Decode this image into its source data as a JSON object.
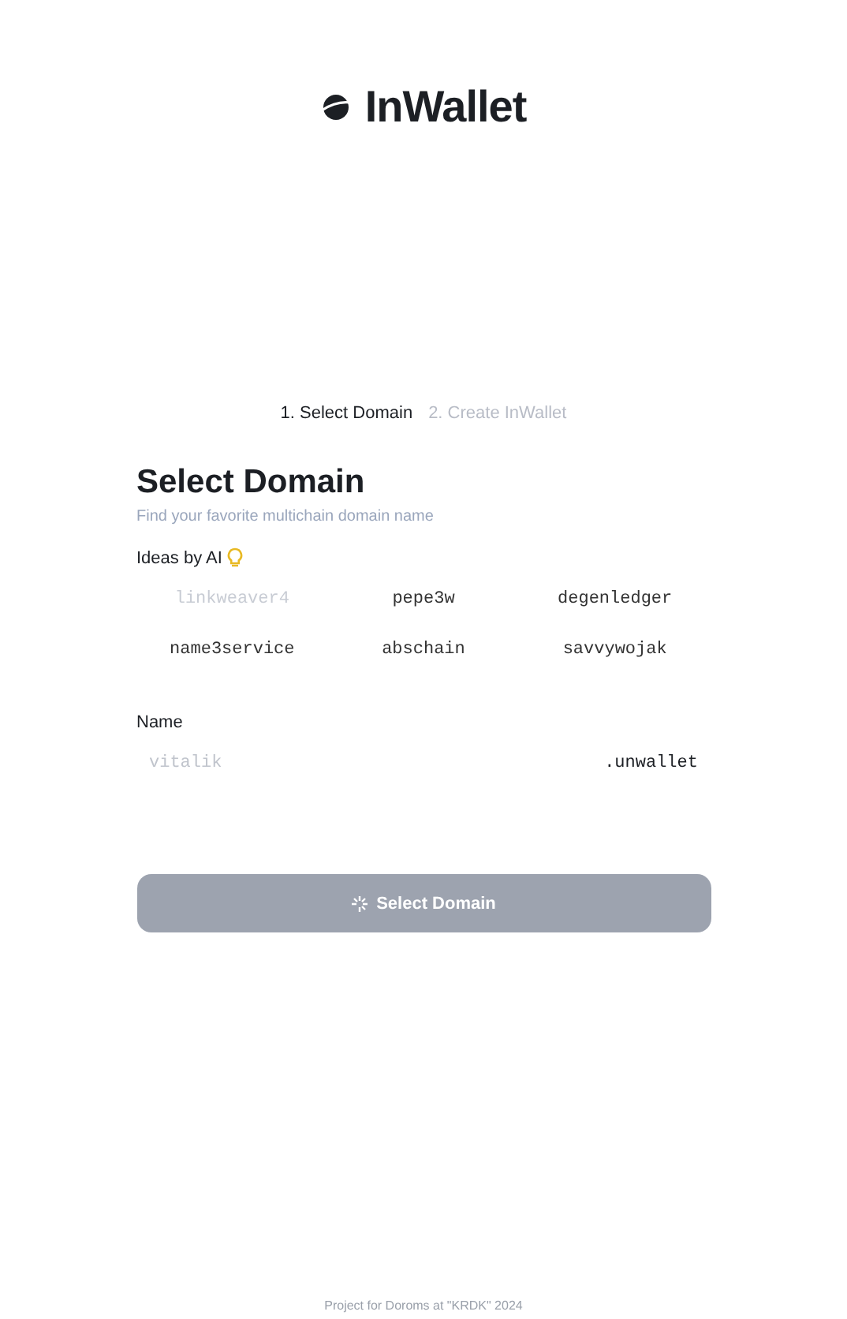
{
  "logo": {
    "text": "InWallet"
  },
  "steps": [
    {
      "label": "1. Select Domain",
      "selected": true
    },
    {
      "label": "2. Create InWallet",
      "selected": false
    }
  ],
  "heading": "Select Domain",
  "subtitle": "Find your favorite multichain domain name",
  "ideas": {
    "label": "Ideas by AI",
    "items": [
      {
        "text": "linkweaver4",
        "disabled": true
      },
      {
        "text": "pepe3w",
        "disabled": false
      },
      {
        "text": "degenledger",
        "disabled": false
      },
      {
        "text": "name3service",
        "disabled": false
      },
      {
        "text": "abschain",
        "disabled": false
      },
      {
        "text": "savvywojak",
        "disabled": false
      }
    ]
  },
  "name_field": {
    "label": "Name",
    "placeholder": "vitalik",
    "suffix": ".unwallet"
  },
  "submit": {
    "label": "Select Domain",
    "disabled": true
  },
  "footer": "Project for Doroms at \"KRDK\" 2024"
}
